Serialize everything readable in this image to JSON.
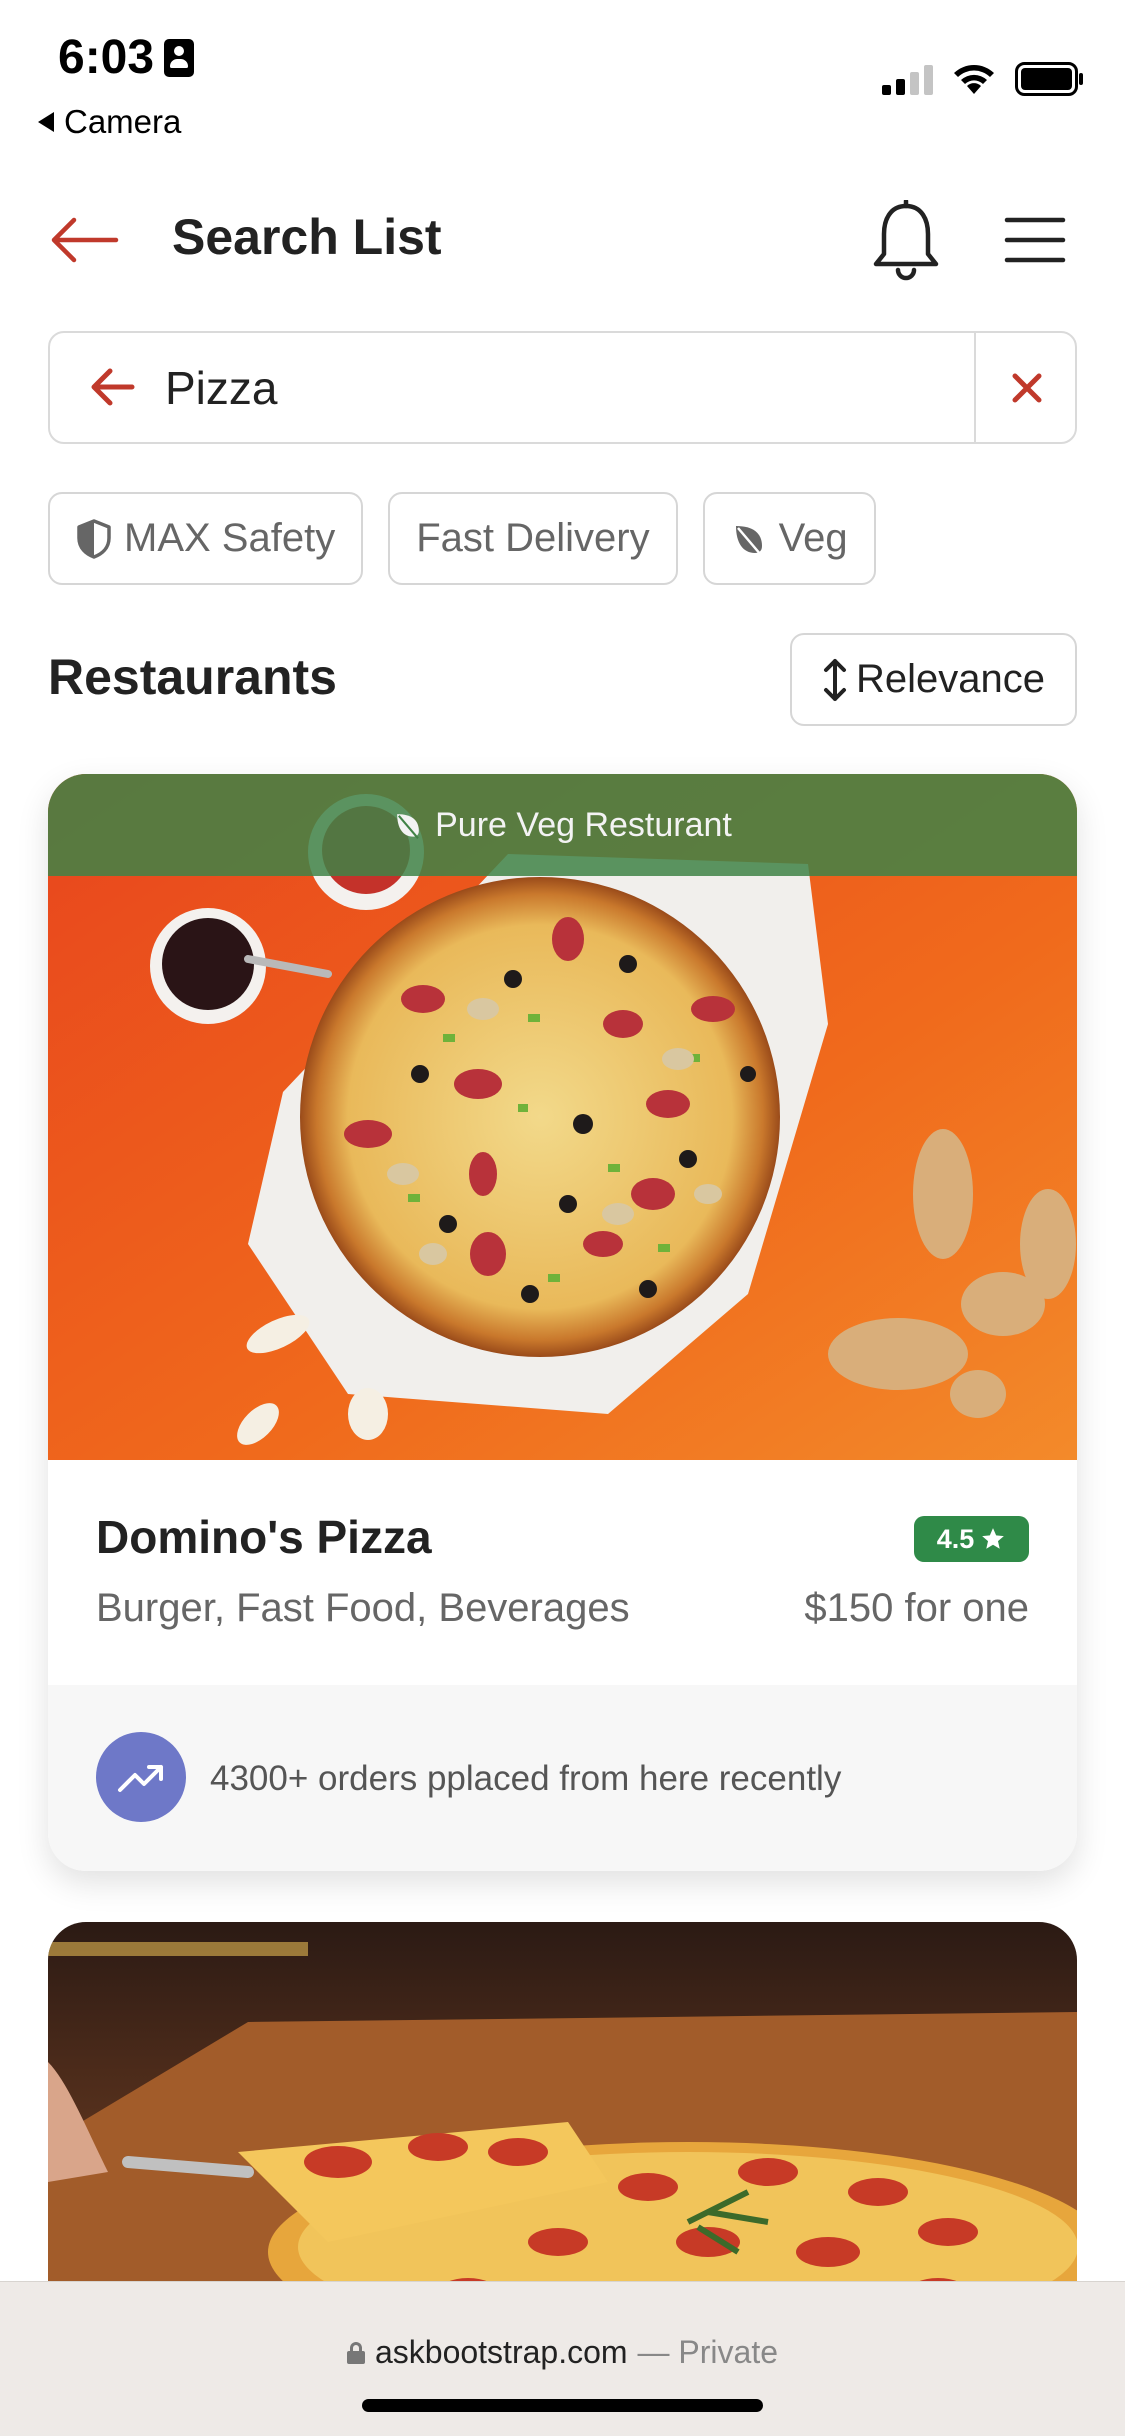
{
  "status_bar": {
    "time": "6:03",
    "back_app": "Camera"
  },
  "header": {
    "title": "Search List"
  },
  "search": {
    "value": "Pizza"
  },
  "filters": [
    {
      "label": "MAX Safety",
      "icon": "shield-icon"
    },
    {
      "label": "Fast Delivery"
    },
    {
      "label": "Veg",
      "icon": "leaf-icon"
    }
  ],
  "section": {
    "title": "Restaurants",
    "sort_label": "Relevance"
  },
  "restaurants": [
    {
      "banner": "Pure Veg Resturant",
      "name": "Domino's Pizza",
      "rating": "4.5",
      "cuisine": "Burger, Fast Food, Beverages",
      "price": "$150 for one",
      "footer": "4300+ orders pplaced from here recently"
    }
  ],
  "browser": {
    "domain": "askbootstrap.com",
    "mode": "— Private"
  },
  "colors": {
    "accent": "#c0392b",
    "veg_banner": "#408246",
    "rating": "#2f8a48",
    "trend_badge": "#6e78c8"
  }
}
